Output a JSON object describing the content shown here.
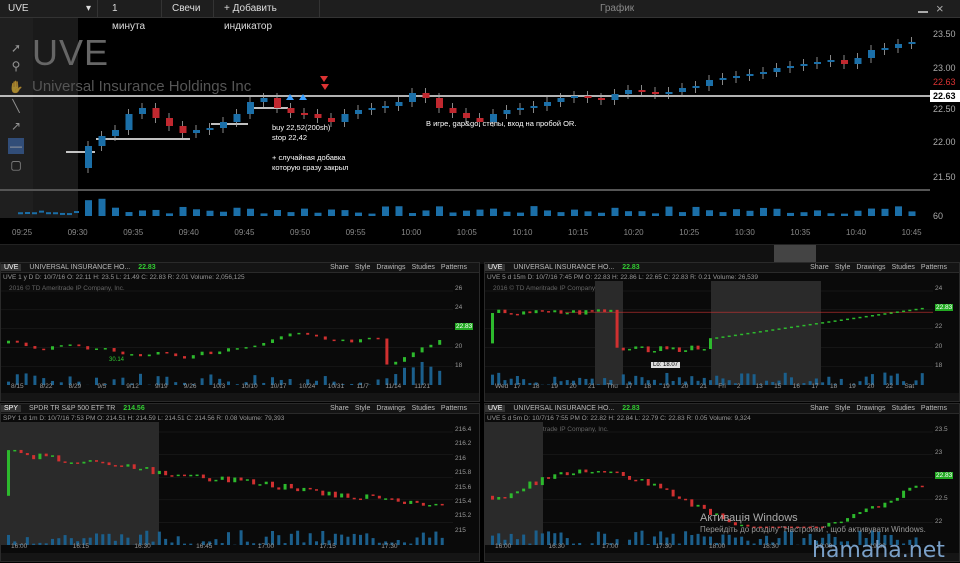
{
  "toolbar": {
    "symbol": "UVE",
    "interval": "1 минута",
    "style": "Свечи",
    "add_indicator": "+ Добавить индикатор",
    "window_title": "График"
  },
  "main": {
    "ticker": "UVE",
    "company": "Universal Insurance Holdings Inc",
    "y_ticks": [
      "23.50",
      "23.00",
      "22.63",
      "22.50",
      "22.00",
      "21.50"
    ],
    "last_price": "22.63",
    "x_ticks": [
      "09:25",
      "09:30",
      "09:35",
      "09:40",
      "09:45",
      "09:50",
      "09:55",
      "10:00",
      "10:05",
      "10:10",
      "10:15",
      "10:20",
      "10:25",
      "10:30",
      "10:35",
      "10:40",
      "10:45"
    ],
    "vol_label": "60",
    "note1": "buy 22,52(200sh)",
    "note2": "stop 22,42",
    "note3": "+ случайная добавка",
    "note4": "которую сразу закрыл",
    "note5": "В игре, gap&go, степы, вход на пробой OR."
  },
  "panels": [
    {
      "sym": "UVE",
      "name": "UNIVERSAL INSURANCE HO...",
      "price": "22.83",
      "tabs": [
        "Share",
        "Style",
        "Drawings",
        "Studies",
        "Patterns"
      ],
      "info": "UVE 1 y D  D: 10/7/16  O: 22.11  H: 23.5  L: 21.49  C: 22.83  R: 2.01  Volume: 2,056,125",
      "copyright": "2016 © TD Ameritrade IP Company, Inc.",
      "y": [
        "26",
        "24",
        "22.83",
        "20",
        "18"
      ],
      "x": [
        "8/15",
        "8/22",
        "8/29",
        "9/5",
        "9/12",
        "9/19",
        "9/26",
        "10/3",
        "10/10",
        "10/17",
        "10/24",
        "10/31",
        "11/7",
        "11/14",
        "11/21"
      ],
      "badge": "30.14"
    },
    {
      "sym": "UVE",
      "name": "UNIVERSAL INSURANCE HO...",
      "price": "22.83",
      "tabs": [
        "Share",
        "Style",
        "Drawings",
        "Studies",
        "Patterns"
      ],
      "info": "UVE 5 d 15m  D: 10/7/16 7:45 PM  O: 22.83  H: 22.86  L: 22.65  C: 22.83  R: 0.21  Volume: 26,539",
      "copyright": "2016 © TD Ameritrade IP Company, Inc.",
      "y": [
        "24",
        "22.83",
        "22",
        "20",
        "18"
      ],
      "x": [
        "Wed",
        "17",
        "18",
        "19",
        "20",
        "21",
        "Thu",
        "17",
        "18",
        "19",
        "20",
        "21",
        "Fri",
        "2",
        "13",
        "15",
        "16",
        "17",
        "18",
        "19",
        "20",
        "22",
        "Sat"
      ],
      "lo": "Lo: 18.07"
    },
    {
      "sym": "SPY",
      "name": "SPDR TR S&P 500 ETF TR",
      "price": "214.56",
      "tabs": [
        "Share",
        "Style",
        "Drawings",
        "Studies",
        "Patterns"
      ],
      "info": "SPY 1 d 1m  D: 10/7/16 7:53 PM  O: 214.51  H: 214.59  L: 214.51  C: 214.56  R: 0.08  Volume: 79,393",
      "copyright": "2016 © TD Ameritrade IP Company, Inc.",
      "y": [
        "216.4",
        "216.2",
        "216",
        "215.8",
        "215.6",
        "215.4",
        "215.2",
        "215"
      ],
      "x": [
        "16:00",
        "16:15",
        "16:30",
        "16:45",
        "17:00",
        "17:15",
        "17:30"
      ]
    },
    {
      "sym": "UVE",
      "name": "UNIVERSAL INSURANCE HO...",
      "price": "22.83",
      "tabs": [
        "Share",
        "Style",
        "Drawings",
        "Studies",
        "Patterns"
      ],
      "info": "UVE 5 d 5m  D: 10/7/16 7:55 PM  O: 22.82  H: 22.84  L: 22.79  C: 22.83  R: 0.05  Volume: 9,324",
      "copyright": "2016 © TD Ameritrade IP Company, Inc.",
      "y": [
        "23.5",
        "23",
        "22.83",
        "22.5",
        "22"
      ],
      "x": [
        "16:00",
        "16:30",
        "17:00",
        "17:30",
        "18:00",
        "18:30",
        "19:00",
        "19:30"
      ]
    }
  ],
  "watermark": {
    "line1": "Активація Windows",
    "line2": "Перейдіть до розділу \"Настройки\", щоб активувати Windows."
  },
  "site": "hamaha.net",
  "colors": {
    "up": "#1b6fa8",
    "down": "#c0282f",
    "green": "#2dba2d",
    "red": "#d03030"
  }
}
